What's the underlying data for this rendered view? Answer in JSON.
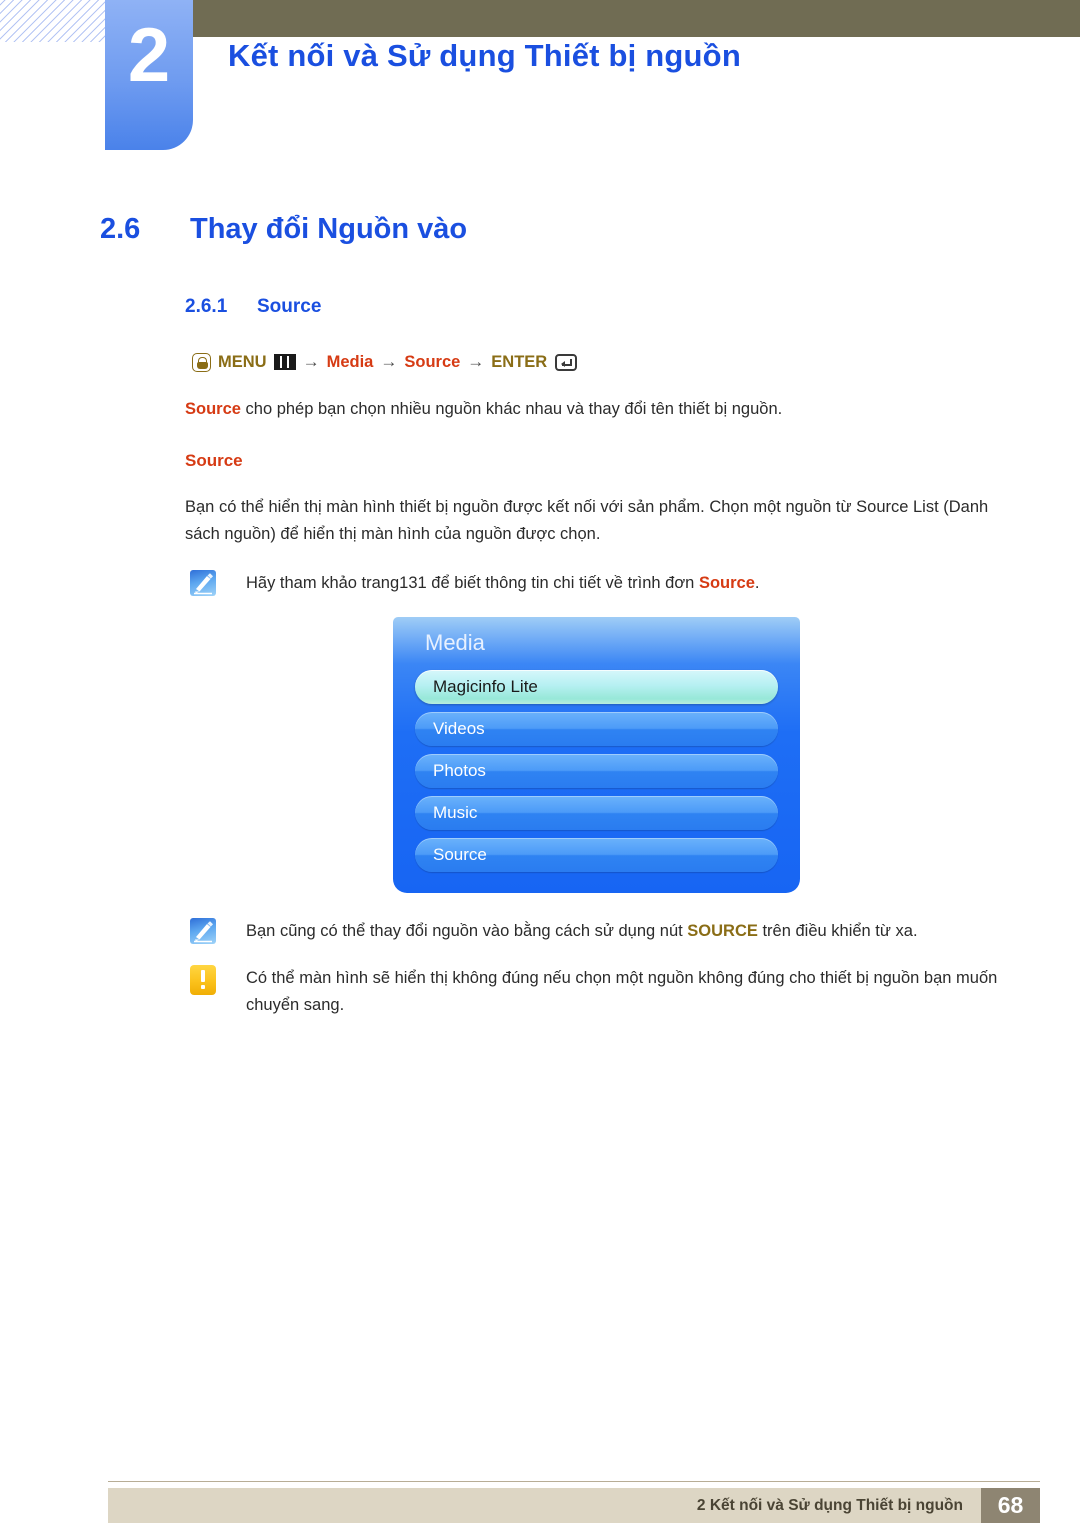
{
  "header": {
    "chapter_number": "2",
    "chapter_title": "Kết nối và Sử dụng Thiết bị nguồn",
    "badge_color": "#6e9bf0",
    "bar_color": "#706c53",
    "title_color": "#1a4fe0"
  },
  "section": {
    "number": "2.6",
    "title": "Thay đổi Nguồn vào",
    "sub_number": "2.6.1",
    "sub_title": "Source"
  },
  "menu_path": {
    "hand_icon": "hand-press-icon",
    "menu_label": "MENU",
    "grid_icon": "menu-grid-icon",
    "arrow": "→",
    "item1": "Media",
    "item2": "Source",
    "enter_label": "ENTER",
    "enter_icon": "enter-return-icon",
    "gold_color": "#8a6d16",
    "red_color": "#d63b14"
  },
  "content": {
    "intro_bold": "Source",
    "intro_rest": " cho phép bạn chọn nhiều nguồn khác nhau và thay đổi tên thiết bị nguồn.",
    "subheading": "Source",
    "description": "Bạn có thể hiển thị màn hình thiết bị nguồn được kết nối với sản phẩm. Chọn một nguồn từ Source List (Danh sách nguồn) để hiển thị màn hình của nguồn được chọn."
  },
  "notes": [
    {
      "icon": "note-pen-icon",
      "text_before": "Hãy tham khảo trang131 để biết thông tin chi tiết về trình đơn ",
      "emphasis": "Source",
      "text_after": ".",
      "emphasis_style": "red"
    },
    {
      "icon": "note-pen-icon",
      "text_before": "Bạn cũng có thể thay đổi nguồn vào bằng cách sử dụng nút ",
      "emphasis": "SOURCE",
      "text_after": " trên điều khiển từ xa.",
      "emphasis_style": "gold"
    },
    {
      "icon": "caution-icon",
      "text_before": "Có thể màn hình sẽ hiển thị không đúng nếu chọn một nguồn không đúng cho thiết bị nguồn bạn muốn chuyển sang.",
      "emphasis": "",
      "text_after": "",
      "emphasis_style": "none"
    }
  ],
  "osd": {
    "title": "Media",
    "items": [
      {
        "label": "Magicinfo Lite",
        "selected": true
      },
      {
        "label": "Videos",
        "selected": false
      },
      {
        "label": "Photos",
        "selected": false
      },
      {
        "label": "Music",
        "selected": false
      },
      {
        "label": "Source",
        "selected": false
      }
    ],
    "panel_color": "#1e6ef5",
    "highlight_color": "#b6f0f2"
  },
  "footer": {
    "text": "2 Kết nối và Sử dụng Thiết bị nguồn",
    "page_number": "68",
    "bar_color": "#ddd6c4",
    "page_box_color": "#8e8572"
  }
}
